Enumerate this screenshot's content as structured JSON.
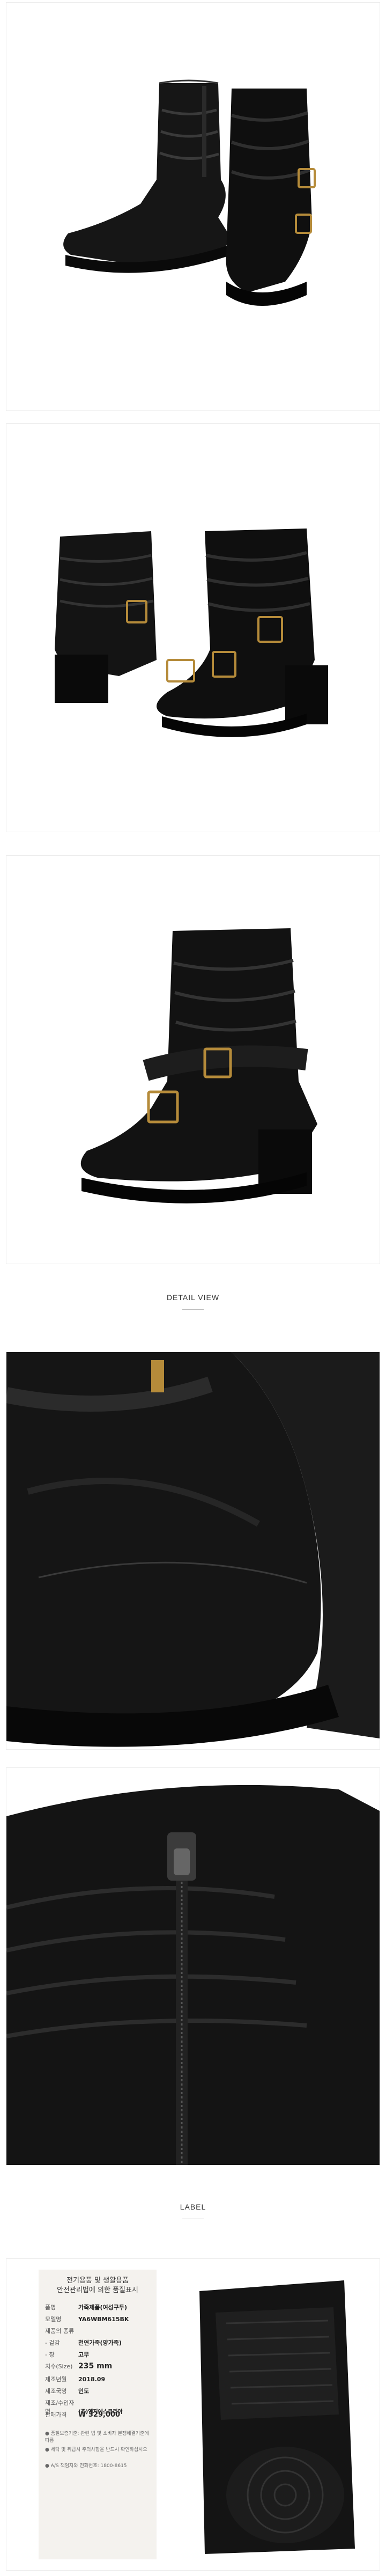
{
  "sections": {
    "detail_title": "DETAIL VIEW",
    "label_title": "LABEL"
  },
  "label": {
    "header_line1": "전기용품 및 생활용품",
    "header_line2": "안전관리법에 의한 품질표시",
    "rows": [
      {
        "key": "품명",
        "value": "가죽제품(여성구두)"
      },
      {
        "key": "모델명",
        "value": "YA6WBM615BK"
      },
      {
        "key": "제품의 종류",
        "value": ""
      },
      {
        "key": "- 겉감",
        "value": "천연가죽(양가죽)"
      },
      {
        "key": "- 창",
        "value": "고무"
      },
      {
        "key": "치수(Size)",
        "value": "235 mm"
      },
      {
        "key": "제조년월",
        "value": "2018.09"
      },
      {
        "key": "제조국명",
        "value": "인도"
      },
      {
        "key": "제조/수입자명",
        "value": "(주)엠지에스코리아"
      },
      {
        "key": "판매가격",
        "value": "W 329,000"
      }
    ],
    "notes": [
      "● 품질보증기준: 관련 법 및 소비자 분쟁해결기준에 따름",
      "● 세탁 및 취급시 주의사항을 반드시 확인하십시오",
      "● A/S 책임자와 전화번호: 1800-8615"
    ]
  },
  "icons": {
    "boot": "boot-photo",
    "sole": "sole-photo"
  }
}
